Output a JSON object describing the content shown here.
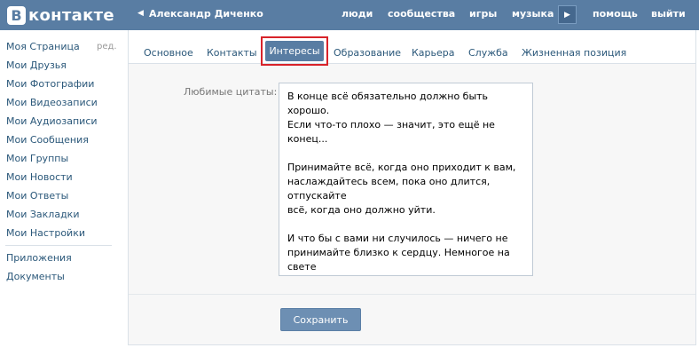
{
  "header": {
    "logo_letter": "В",
    "logo_text": "контакте",
    "back_arrow": "◀",
    "user_name": "Александр Диченко",
    "nav": {
      "people": "люди",
      "communities": "сообщества",
      "games": "игры",
      "music": "музыка",
      "play": "▶",
      "help": "помощь",
      "exit": "выйти"
    },
    "bg_color": "#597da3"
  },
  "sidebar": {
    "edit_label": "ред.",
    "items": [
      {
        "label": "Моя Страница"
      },
      {
        "label": "Мои Друзья"
      },
      {
        "label": "Мои Фотографии"
      },
      {
        "label": "Мои Видеозаписи"
      },
      {
        "label": "Мои Аудиозаписи"
      },
      {
        "label": "Мои Сообщения"
      },
      {
        "label": "Мои Группы"
      },
      {
        "label": "Мои Новости"
      },
      {
        "label": "Мои Ответы"
      },
      {
        "label": "Мои Закладки"
      },
      {
        "label": "Мои Настройки"
      }
    ],
    "extra": [
      {
        "label": "Приложения"
      },
      {
        "label": "Документы"
      }
    ]
  },
  "tabs": [
    {
      "label": "Основное"
    },
    {
      "label": "Контакты"
    },
    {
      "label": "Интересы",
      "active": true
    },
    {
      "label": "Образование"
    },
    {
      "label": "Карьера"
    },
    {
      "label": "Служба"
    },
    {
      "label": "Жизненная позиция"
    }
  ],
  "form": {
    "quotes_label": "Любимые цитаты:",
    "quotes_value": "В конце всё обязательно должно быть хорошо.\nЕсли что-то плохо — значит, это ещё не конец...\n\nПринимайте всё, когда оно приходит к вам,\nнаслаждайтесь всем, пока оно длится, отпускайте\nвсё, когда оно должно уйти.\n\nИ что бы с вами ни случилось — ничего не\nпринимайте близко к сердцу. Немногое на свете\nдолго бывает важным.\n\nОдно слово может изменить твое решение...Одно\nчувство может изменить твою жизнь...Один\nчеловек может изменить тебя...",
    "save_label": "Сохранить"
  },
  "colors": {
    "accent": "#597da3",
    "link": "#2b587a",
    "highlight": "#d8232a"
  }
}
